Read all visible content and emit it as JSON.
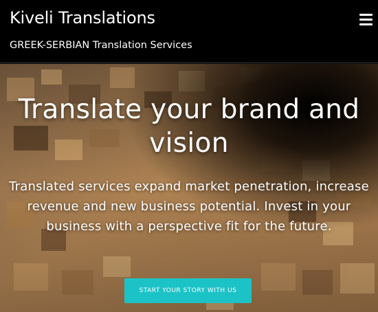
{
  "header": {
    "title": "Kiveli Translations",
    "tagline": "GREEK-SERBIAN Translation Services",
    "menu_icon": "hamburger-menu-icon"
  },
  "hero": {
    "title": "Translate your brand and vision",
    "text": "Translated services expand market penetration, increase revenue and new business potential. Invest in your business with a perspective fit for the future.",
    "cta_label": "START YOUR STORY WITH US",
    "background_image": "wooden-blocks-vortex-photo"
  },
  "colors": {
    "header_bg": "#000000",
    "cta_bg": "#1cc3c6",
    "text": "#ffffff"
  }
}
